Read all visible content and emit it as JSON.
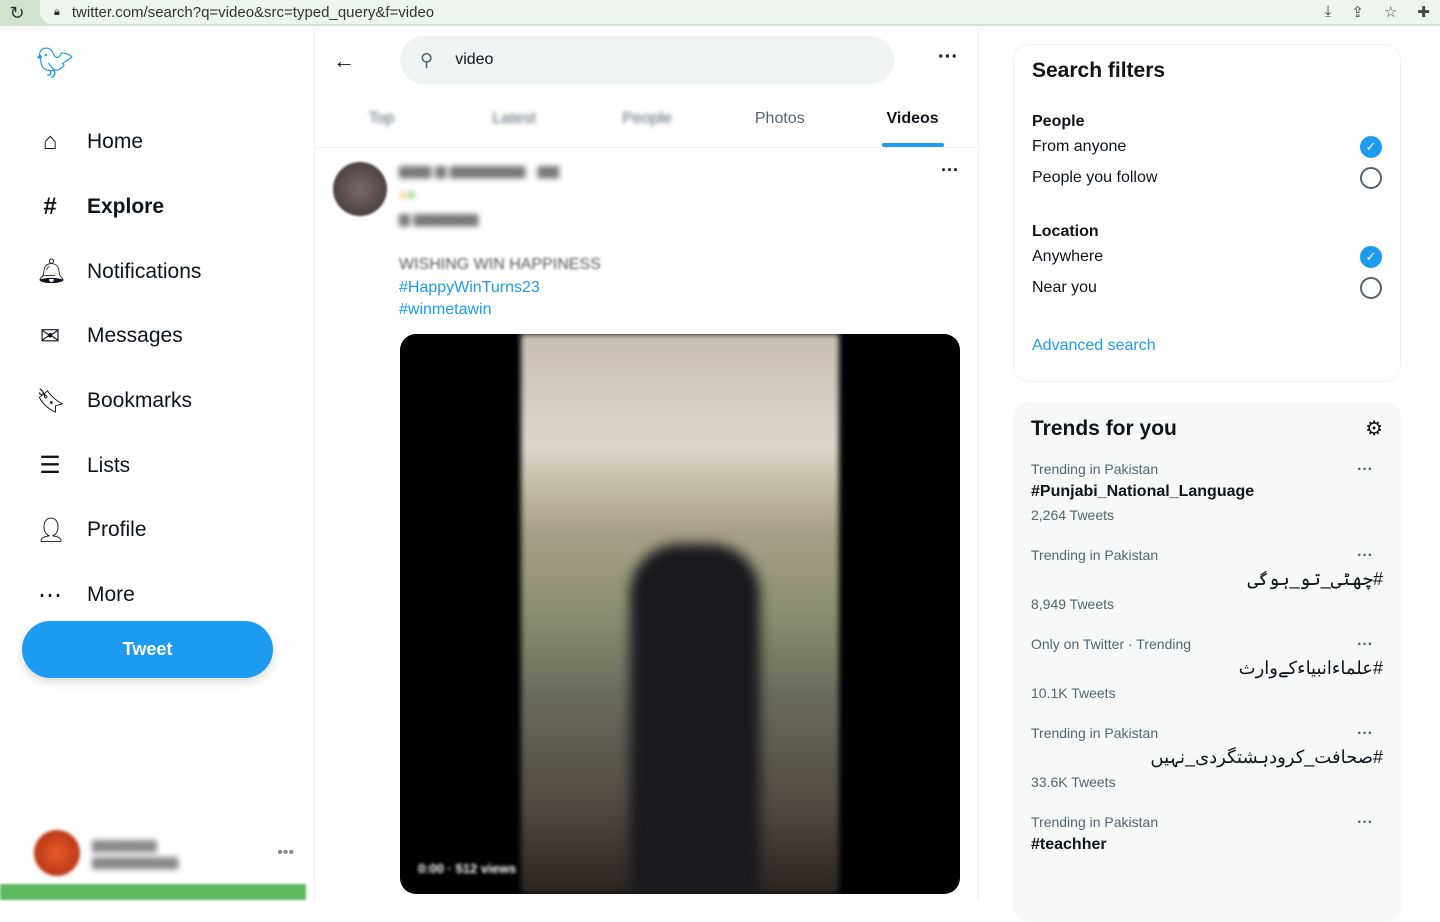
{
  "browser": {
    "url": "twitter.com/search?q=video&src=typed_query&f=video"
  },
  "sidebar": {
    "items": [
      {
        "label": "Home",
        "icon": "home-icon",
        "glyph": "⌂"
      },
      {
        "label": "Explore",
        "icon": "hashtag-icon",
        "glyph": "#",
        "active": true
      },
      {
        "label": "Notifications",
        "icon": "bell-icon",
        "glyph": "🔔︎"
      },
      {
        "label": "Messages",
        "icon": "mail-icon",
        "glyph": "✉"
      },
      {
        "label": "Bookmarks",
        "icon": "bookmark-icon",
        "glyph": "🔖︎"
      },
      {
        "label": "Lists",
        "icon": "list-icon",
        "glyph": "☰"
      },
      {
        "label": "Profile",
        "icon": "person-icon",
        "glyph": "👤︎"
      },
      {
        "label": "More",
        "icon": "more-circle-icon",
        "glyph": "⋯"
      }
    ],
    "tweet_label": "Tweet"
  },
  "search": {
    "value": "video"
  },
  "tabs": [
    {
      "label": "Top"
    },
    {
      "label": "Latest"
    },
    {
      "label": "People"
    },
    {
      "label": "Photos"
    },
    {
      "label": "Videos"
    }
  ],
  "post": {
    "text": "WISHING WIN HAPPINESS",
    "hashtags": [
      "#HappyWinTurns23",
      "#winmetawin"
    ]
  },
  "filters": {
    "title": "Search filters",
    "people_label": "People",
    "people": [
      {
        "label": "From anyone",
        "checked": true
      },
      {
        "label": "People you follow",
        "checked": false
      }
    ],
    "location_label": "Location",
    "location": [
      {
        "label": "Anywhere",
        "checked": true
      },
      {
        "label": "Near you",
        "checked": false
      }
    ],
    "advanced": "Advanced search"
  },
  "trends": {
    "title": "Trends for you",
    "items": [
      {
        "context": "Trending in Pakistan",
        "name": "#Punjabi_National_Language",
        "count": "2,264 Tweets"
      },
      {
        "context": "Trending in Pakistan",
        "name": "#چھٹی_تو_ہوگی",
        "count": "8,949 Tweets",
        "rtl": true
      },
      {
        "context": "Only on Twitter · Trending",
        "name": "#علماءانبیاءکےوارث",
        "count": "10.1K Tweets",
        "rtl": true
      },
      {
        "context": "Trending in Pakistan",
        "name": "#صحافت_کرودہشتگردی_نہیں",
        "count": "33.6K Tweets",
        "rtl": true
      },
      {
        "context": "Trending in Pakistan",
        "name": "#teachher",
        "count": ""
      }
    ]
  },
  "colors": {
    "accent": "#1d9bf0"
  }
}
